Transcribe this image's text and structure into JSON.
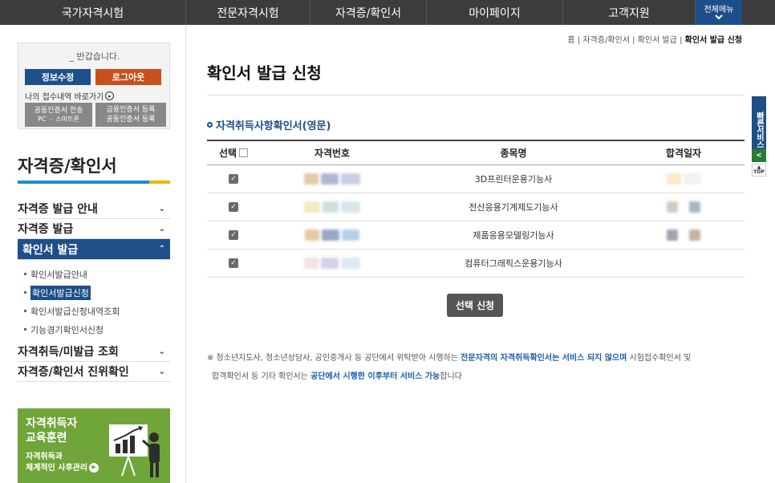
{
  "topnav": {
    "items": [
      "국가자격시험",
      "전문자격시험",
      "자격증/확인서",
      "마이페이지",
      "고객지원"
    ],
    "all_menu": "전체메뉴",
    "all_menu_icon": "chevron-down-icon"
  },
  "login": {
    "greeting": "_ 반갑습니다.",
    "edit_button": "정보수정",
    "logout_button": "로그아웃",
    "shortcut": "나의 접수내역 바로가기",
    "cert_transfer": "공동인증서 전송",
    "cert_transfer_pc": "PC",
    "cert_transfer_arrow": "→",
    "cert_transfer_phone": "스마트폰",
    "financial_cert": "금융인증서 등록",
    "joint_cert": "공동인증서 등록"
  },
  "sidebar": {
    "title": "자격증/확인서",
    "menu": [
      {
        "label": "자격증 발급 안내"
      },
      {
        "label": "자격증 발급"
      },
      {
        "label": "확인서 발급"
      }
    ],
    "sub_items": [
      "확인서발급안내",
      "확인서발급신청",
      "확인서발급신청내역조회",
      "기능경기확인서신청"
    ],
    "menu_after": [
      {
        "label": "자격취득/미발급 조회"
      },
      {
        "label": "자격증/확인서 진위확인"
      }
    ],
    "banner": {
      "line1": "자격취득자",
      "line2": "교육훈련",
      "line3": "자격취득과",
      "line4": "체계적인 사후관리"
    }
  },
  "breadcrumb": {
    "home": "홈",
    "sep": "|",
    "level1": "자격증/확인서",
    "level2": "확인서 발급",
    "current": "확인서 발급 신청"
  },
  "page": {
    "title": "확인서 발급 신청",
    "section_title": "자격취득사항확인서(영문)"
  },
  "table": {
    "headers": {
      "select": "선택",
      "number": "자격번호",
      "subject": "종목명",
      "date": "합격일자"
    },
    "rows": [
      {
        "subject": "3D프린터운용기능사",
        "checked": true
      },
      {
        "subject": "전산응용기계제도기능사",
        "checked": true
      },
      {
        "subject": "제품응용모델링기능사",
        "checked": true
      },
      {
        "subject": "컴퓨터그래픽스운용기능사",
        "checked": true
      }
    ],
    "check_mark": "✓"
  },
  "select_button": "선택 신청",
  "notice": {
    "part1": "※ 청소년지도사, 청소년상담사, 공인중개사 등 공단에서 위탁받아 시행하는 ",
    "highlight1": "전문자격의 자격취득확인서는 서비스 되지 않으며",
    "part2": " 시험접수확인서 및",
    "part3": "합격확인서 등 기타 확인서는 ",
    "highlight2": "공단에서 시행한 이후부터 서비스 가능",
    "part4": "합니다"
  },
  "quick": {
    "label": "빠른서비스",
    "arrow": "<",
    "top": "TOP"
  }
}
